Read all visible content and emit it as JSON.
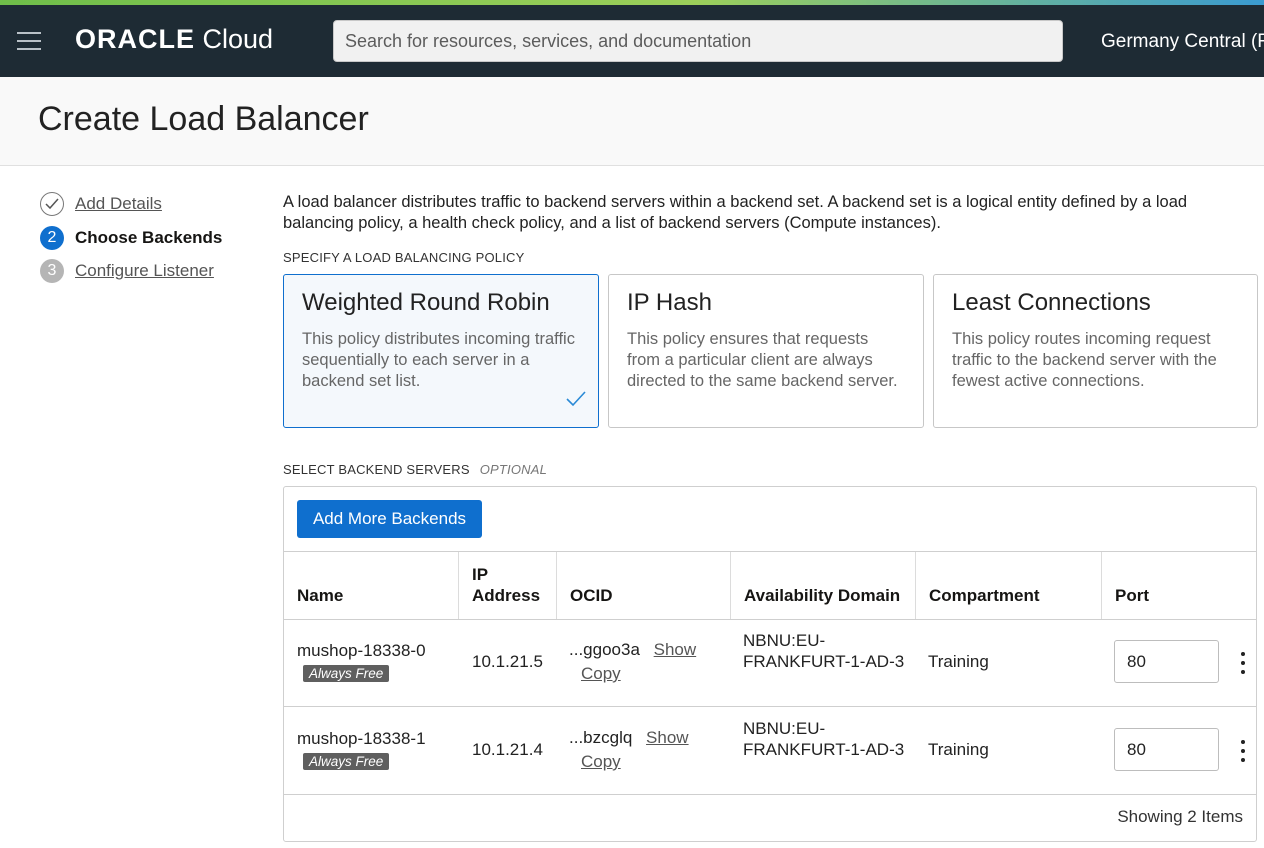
{
  "topbar": {
    "logo_brand": "ORACLE",
    "logo_product": "Cloud",
    "search_placeholder": "Search for resources, services, and documentation",
    "region": "Germany Central (F"
  },
  "page": {
    "title": "Create Load Balancer"
  },
  "steps": [
    {
      "number": "",
      "label": "Add Details",
      "state": "done"
    },
    {
      "number": "2",
      "label": "Choose Backends",
      "state": "active"
    },
    {
      "number": "3",
      "label": "Configure Listener",
      "state": "todo"
    }
  ],
  "intro": "A load balancer distributes traffic to backend servers within a backend set. A backend set is a logical entity defined by a load balancing policy, a health check policy, and a list of backend servers (Compute instances).",
  "policy_section": {
    "heading": "SPECIFY A LOAD BALANCING POLICY",
    "cards": [
      {
        "title": "Weighted Round Robin",
        "description": "This policy distributes incoming traffic sequentially to each server in a backend set list.",
        "selected": true
      },
      {
        "title": "IP Hash",
        "description": "This policy ensures that requests from a particular client are always directed to the same backend server.",
        "selected": false
      },
      {
        "title": "Least Connections",
        "description": "This policy routes incoming request traffic to the backend server with the fewest active connections.",
        "selected": false
      }
    ]
  },
  "backend_section": {
    "heading": "SELECT BACKEND SERVERS",
    "optional": "OPTIONAL",
    "add_button": "Add More Backends",
    "columns": [
      "Name",
      "IP Address",
      "OCID",
      "Availability Domain",
      "Compartment",
      "Port"
    ],
    "rows": [
      {
        "name": "mushop-18338-0",
        "badge": "Always Free",
        "ip": "10.1.21.5",
        "ocid": "...ggoo3a",
        "show": "Show",
        "copy": "Copy",
        "ad": "NBNU:EU-FRANKFURT-1-AD-3",
        "compartment": "Training",
        "port": "80"
      },
      {
        "name": "mushop-18338-1",
        "badge": "Always Free",
        "ip": "10.1.21.4",
        "ocid": "...bzcglq",
        "show": "Show",
        "copy": "Copy",
        "ad": "NBNU:EU-FRANKFURT-1-AD-3",
        "compartment": "Training",
        "port": "80"
      }
    ],
    "footer": "Showing 2 Items"
  },
  "colors": {
    "topbar": "#1e2b34",
    "accent_blue": "#0f6fce",
    "badge": "#5f5f5f"
  }
}
